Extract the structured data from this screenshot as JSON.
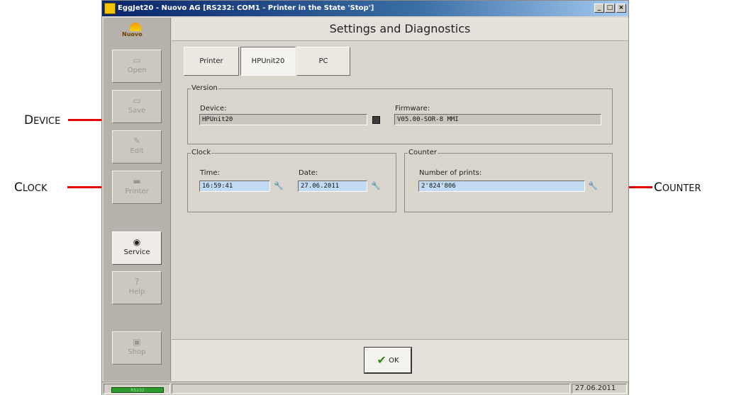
{
  "window": {
    "title": "EggJet20 - Nuovo AG   [RS232: COM1 - Printer in the State 'Stop']",
    "controls": [
      "_",
      "□",
      "×"
    ]
  },
  "logo_text": "Nuovo",
  "sidebar": {
    "items": [
      {
        "label": "Open",
        "icon": "folder-icon",
        "glyph": "▭",
        "enabled": false
      },
      {
        "label": "Save",
        "icon": "floppy-icon",
        "glyph": "▭",
        "enabled": false
      },
      {
        "label": "Edit",
        "icon": "edit-icon",
        "glyph": "✎",
        "enabled": false
      },
      {
        "label": "Printer",
        "icon": "printer-icon",
        "glyph": "▬",
        "enabled": false
      },
      {
        "label": "Service",
        "icon": "gear-icon",
        "glyph": "◉",
        "enabled": true,
        "active": true
      },
      {
        "label": "Help",
        "icon": "help-icon",
        "glyph": "?",
        "enabled": false
      },
      {
        "label": "Shop",
        "icon": "shop-icon",
        "glyph": "▣",
        "enabled": false
      }
    ]
  },
  "header": {
    "title": "Settings and Diagnostics"
  },
  "tabs": [
    {
      "label": "Printer",
      "active": false
    },
    {
      "label": "HPUnit20",
      "active": true
    },
    {
      "label": "PC",
      "active": false
    }
  ],
  "version": {
    "group_label": "Version",
    "device_label": "Device:",
    "device_value": "HPUnit20",
    "firmware_label": "Firmware:",
    "firmware_value": "V05.00-SOR-8 MMI"
  },
  "clock": {
    "group_label": "Clock",
    "time_label": "Time:",
    "time_value": "16:59:41",
    "date_label": "Date:",
    "date_value": "27.06.2011"
  },
  "counter": {
    "group_label": "Counter",
    "prints_label": "Number of prints:",
    "prints_value": "2'824'806"
  },
  "ok_button": {
    "label": "OK"
  },
  "status": {
    "connection": "RS232",
    "date": "27.06.2011"
  },
  "annotations": {
    "device": {
      "first": "D",
      "rest": "EVICE"
    },
    "clock": {
      "first": "C",
      "rest": "LOCK"
    },
    "counter": {
      "first": "C",
      "rest": "OUNTER"
    }
  },
  "colors": {
    "titlebar": "#0a246a",
    "callout_line": "#e00000",
    "editable_field": "#c3daf3",
    "ok_check": "#2a8a16"
  }
}
